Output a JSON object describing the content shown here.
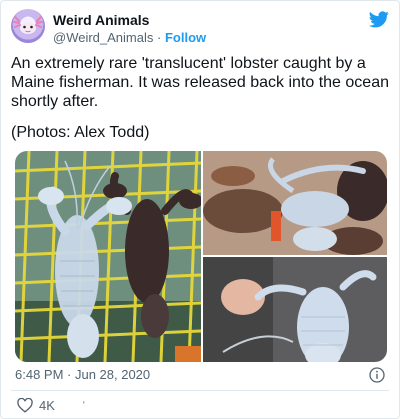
{
  "tweet": {
    "author": {
      "display_name": "Weird Animals",
      "handle": "@Weird_Animals",
      "separator": "·",
      "follow_label": "Follow",
      "avatar_icon": "axolotl-avatar"
    },
    "brand_icon": "twitter-bird-icon",
    "text": "An extremely rare 'translucent' lobster caught by a Maine fisherman. It was released back into the ocean shortly after.",
    "credit": "(Photos: Alex Todd)",
    "media": [
      {
        "description_icon": "translucent-lobster-on-trap-photo"
      },
      {
        "description_icon": "lobster-pile-photo"
      },
      {
        "description_icon": "lobster-held-in-hand-photo"
      }
    ],
    "timestamp": "6:48 PM · Jun 28, 2020",
    "likes": "4K",
    "actions_separator": "'",
    "colors": {
      "link": "#1d9bf0",
      "secondary_text": "#536471",
      "text": "#0f1419"
    }
  }
}
